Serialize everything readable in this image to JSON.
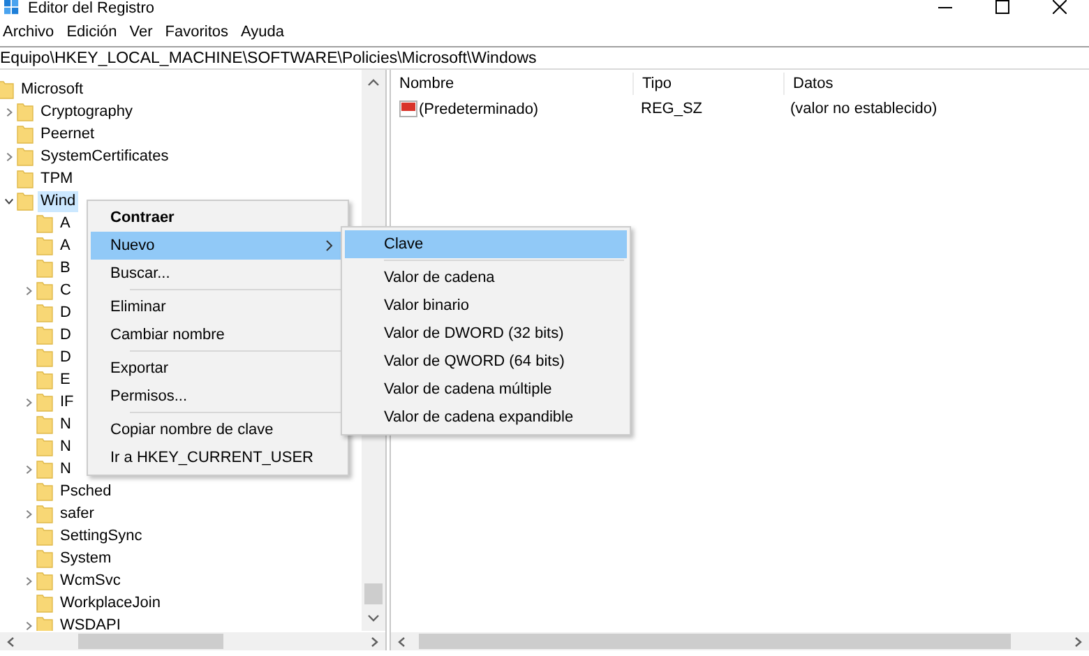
{
  "window": {
    "title": "Editor del Registro"
  },
  "menu_bar": [
    "Archivo",
    "Edición",
    "Ver",
    "Favoritos",
    "Ayuda"
  ],
  "address": "Equipo\\HKEY_LOCAL_MACHINE\\SOFTWARE\\Policies\\Microsoft\\Windows",
  "tree": [
    {
      "label": "Microsoft",
      "selected": false,
      "children": [
        {
          "label": "Cryptography",
          "expanded": false,
          "selected": false
        },
        {
          "label": "Peernet",
          "selected": false
        },
        {
          "label": "SystemCertificates",
          "expanded": false,
          "selected": false
        },
        {
          "label": "TPM",
          "selected": false
        },
        {
          "label": "Wind",
          "expanded": true,
          "selected": true,
          "children": [
            {
              "label": "A",
              "selected": false
            },
            {
              "label": "A",
              "selected": false
            },
            {
              "label": "B",
              "selected": false
            },
            {
              "label": "C",
              "expanded": false,
              "selected": false
            },
            {
              "label": "D",
              "selected": false
            },
            {
              "label": "D",
              "selected": false
            },
            {
              "label": "D",
              "selected": false
            },
            {
              "label": "E",
              "selected": false
            },
            {
              "label": "IF",
              "expanded": false,
              "selected": false
            },
            {
              "label": "N",
              "selected": false
            },
            {
              "label": "N",
              "selected": false
            },
            {
              "label": "N",
              "expanded": false,
              "selected": false
            },
            {
              "label": "Psched",
              "selected": false
            },
            {
              "label": "safer",
              "expanded": false,
              "selected": false
            },
            {
              "label": "SettingSync",
              "selected": false
            },
            {
              "label": "System",
              "selected": false
            },
            {
              "label": "WcmSvc",
              "expanded": false,
              "selected": false
            },
            {
              "label": "WorkplaceJoin",
              "selected": false
            },
            {
              "label": "WSDAPI",
              "expanded": false,
              "selected": false
            }
          ]
        }
      ]
    }
  ],
  "table": {
    "columns": [
      "Nombre",
      "Tipo",
      "Datos"
    ],
    "rows": [
      {
        "name": "(Predeterminado)",
        "type": "REG_SZ",
        "data": "(valor no establecido)"
      }
    ]
  },
  "context_menu": {
    "groups": [
      [
        {
          "label": "Contraer",
          "default": true,
          "selected": false,
          "submenu": false
        },
        {
          "label": "Nuevo",
          "default": false,
          "selected": true,
          "submenu": true
        },
        {
          "label": "Buscar...",
          "default": false,
          "selected": false,
          "submenu": false
        }
      ],
      [
        {
          "label": "Eliminar",
          "default": false,
          "selected": false,
          "submenu": false
        },
        {
          "label": "Cambiar nombre",
          "default": false,
          "selected": false,
          "submenu": false
        }
      ],
      [
        {
          "label": "Exportar",
          "default": false,
          "selected": false,
          "submenu": false
        },
        {
          "label": "Permisos...",
          "default": false,
          "selected": false,
          "submenu": false
        }
      ],
      [
        {
          "label": "Copiar nombre de clave",
          "default": false,
          "selected": false,
          "submenu": false
        },
        {
          "label": "Ir a HKEY_CURRENT_USER",
          "default": false,
          "selected": false,
          "submenu": false
        }
      ]
    ]
  },
  "submenu": {
    "groups": [
      [
        {
          "label": "Clave",
          "selected": true
        }
      ],
      [
        {
          "label": "Valor de cadena",
          "selected": false
        },
        {
          "label": "Valor binario",
          "selected": false
        },
        {
          "label": "Valor de DWORD (32 bits)",
          "selected": false
        },
        {
          "label": "Valor de QWORD (64 bits)",
          "selected": false
        },
        {
          "label": "Valor de cadena múltiple",
          "selected": false
        },
        {
          "label": "Valor de cadena expandible",
          "selected": false
        }
      ]
    ]
  }
}
